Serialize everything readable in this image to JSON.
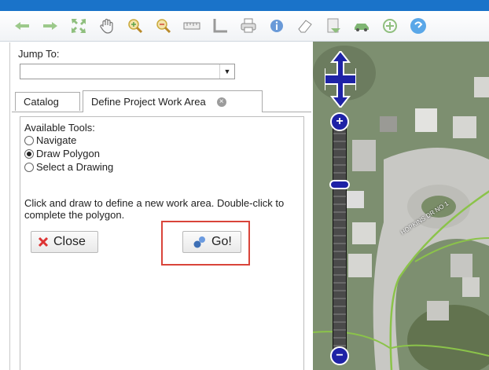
{
  "toolbar": {
    "icons": [
      "back-arrow-icon",
      "forward-arrow-icon",
      "full-extent-icon",
      "pan-hand-icon",
      "zoom-in-icon",
      "zoom-out-icon",
      "measure-ruler-icon",
      "measure-area-icon",
      "print-icon",
      "info-icon",
      "eraser-icon",
      "document-icon",
      "car-icon",
      "add-layer-icon",
      "help-icon"
    ],
    "accent": "#1a73c9"
  },
  "jump": {
    "label": "Jump To:",
    "value": ""
  },
  "tabs": [
    {
      "label": "Catalog"
    },
    {
      "label": "Define Project Work Area"
    }
  ],
  "tools": {
    "label": "Available Tools:",
    "options": [
      {
        "label": "Navigate",
        "selected": false
      },
      {
        "label": "Draw Polygon",
        "selected": true
      },
      {
        "label": "Select a Drawing",
        "selected": false
      }
    ]
  },
  "help_text": "Click and draw to define a new work area. Double-click to complete the polygon.",
  "buttons": {
    "close": "Close",
    "go": "Go!"
  },
  "map": {
    "street_label": "HOPKINS DR NO 1"
  }
}
